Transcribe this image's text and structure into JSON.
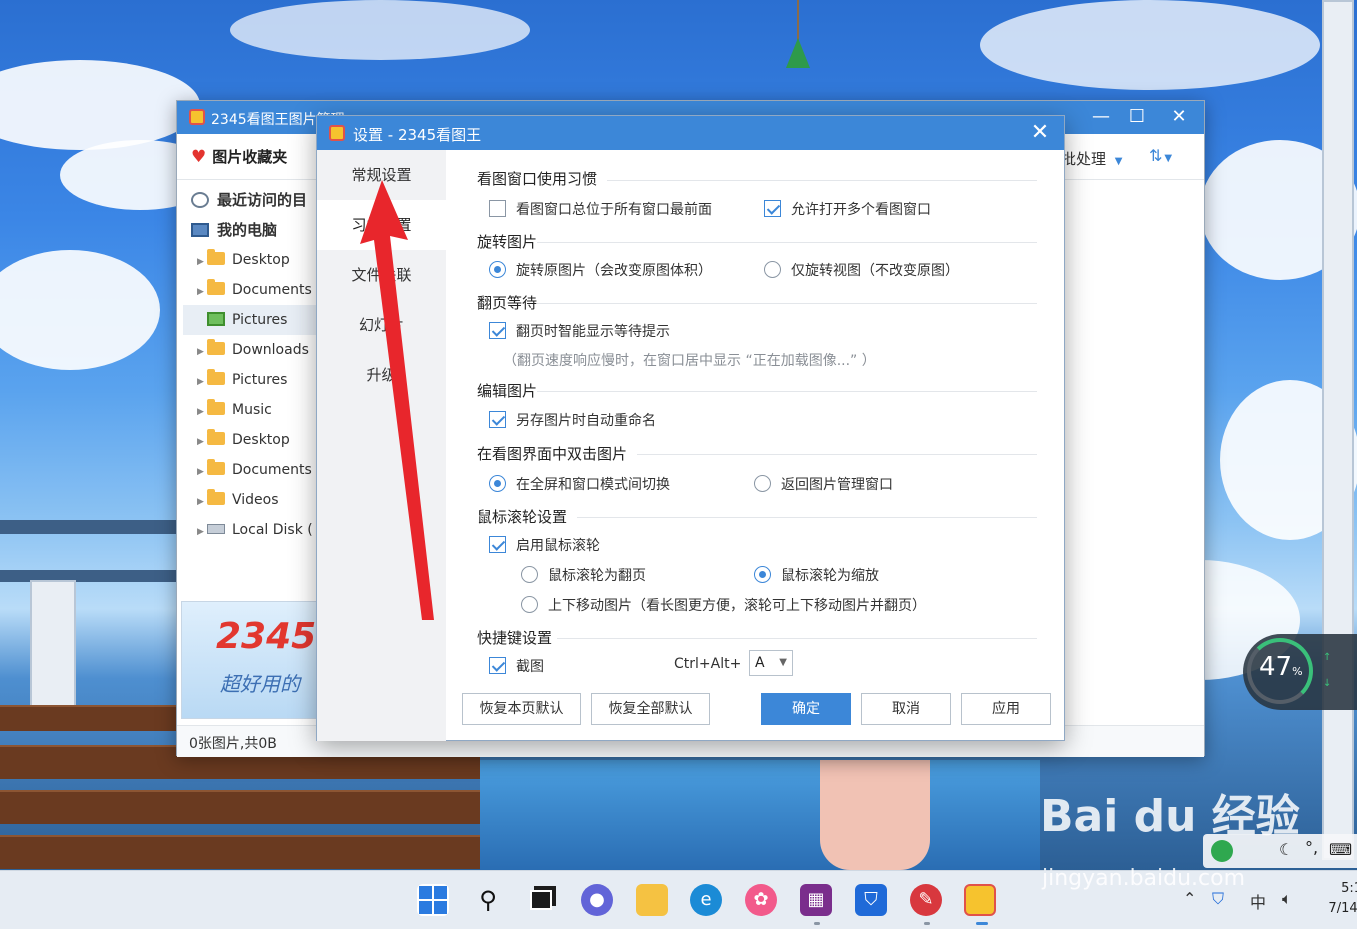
{
  "main_window": {
    "title": "2345看图王图片管理",
    "favorites_label": "图片收藏夹",
    "batch_label": "批处理",
    "tree": [
      {
        "label": "最近访问的目",
        "kind": "top"
      },
      {
        "label": "我的电脑",
        "kind": "top"
      },
      {
        "label": "Desktop",
        "kind": "sub"
      },
      {
        "label": "Documents",
        "kind": "sub"
      },
      {
        "label": "Pictures",
        "kind": "sub"
      },
      {
        "label": "Downloads",
        "kind": "sub"
      },
      {
        "label": "Pictures",
        "kind": "sub"
      },
      {
        "label": "Music",
        "kind": "sub"
      },
      {
        "label": "Desktop",
        "kind": "sub"
      },
      {
        "label": "Documents",
        "kind": "sub"
      },
      {
        "label": "Videos",
        "kind": "sub"
      },
      {
        "label": "Local Disk (",
        "kind": "sub"
      }
    ],
    "ad_number": "2345",
    "ad_text": "超好用的",
    "status": "0张图片,共0B"
  },
  "dialog": {
    "title": "设置 - 2345看图王",
    "nav": [
      "常规设置",
      "习惯设置",
      "文件关联",
      "幻灯片",
      "升级"
    ],
    "sections": {
      "window_habit": "看图窗口使用习惯",
      "always_on_top": "看图窗口总位于所有窗口最前面",
      "allow_multi": "允许打开多个看图窗口",
      "rotate": "旋转图片",
      "rotate_original": "旋转原图片（会改变原图体积）",
      "rotate_view": "仅旋转视图（不改变原图）",
      "page_wait": "翻页等待",
      "smart_wait": "翻页时智能显示等待提示",
      "wait_hint": "（翻页速度响应慢时，在窗口居中显示 “正在加载图像...” ）",
      "edit": "编辑图片",
      "auto_rename": "另存图片时自动重命名",
      "dblclick": "在看图界面中双击图片",
      "toggle_fullscreen": "在全屏和窗口模式间切换",
      "back_manager": "返回图片管理窗口",
      "wheel": "鼠标滚轮设置",
      "enable_wheel": "启用鼠标滚轮",
      "wheel_page": "鼠标滚轮为翻页",
      "wheel_zoom": "鼠标滚轮为缩放",
      "wheel_move": "上下移动图片（看长图更方便，滚轮可上下移动图片并翻页）",
      "hotkey": "快捷键设置",
      "screenshot": "截图",
      "hotkey_combo": "Ctrl+Alt+",
      "hotkey_key": "A"
    },
    "buttons": {
      "reset_page": "恢复本页默认",
      "reset_all": "恢复全部默认",
      "ok": "确定",
      "cancel": "取消",
      "apply": "应用"
    }
  },
  "widget": {
    "percent": "47",
    "unit": "%"
  },
  "watermark": {
    "brand": "Bai du 经验",
    "site": "jingyan.baidu.com"
  },
  "tray": {
    "time": "5:1",
    "date": "7/14/",
    "ime": "中"
  },
  "colors": {
    "accent": "#3c87d8",
    "arrow": "#e8262c"
  }
}
